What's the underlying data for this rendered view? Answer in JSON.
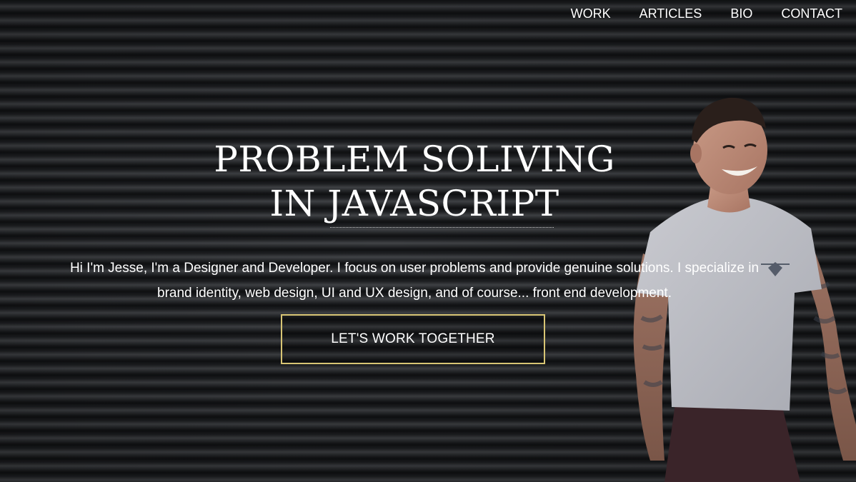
{
  "nav": {
    "items": [
      {
        "label": "WORK"
      },
      {
        "label": "ARTICLES"
      },
      {
        "label": "BIO"
      },
      {
        "label": "CONTACT"
      }
    ]
  },
  "hero": {
    "headline_line1": "PROBLEM SOLIVING",
    "headline_line2": "IN JAVASCRIPT",
    "intro": "Hi I'm Jesse, I'm a Designer and Developer. I focus on user problems and provide genuine solutions. I specialize in brand identity, web design, UI and UX design, and of course... front end development.",
    "cta_label": "LET'S WORK TOGETHER",
    "accent_color": "#d8c574"
  }
}
